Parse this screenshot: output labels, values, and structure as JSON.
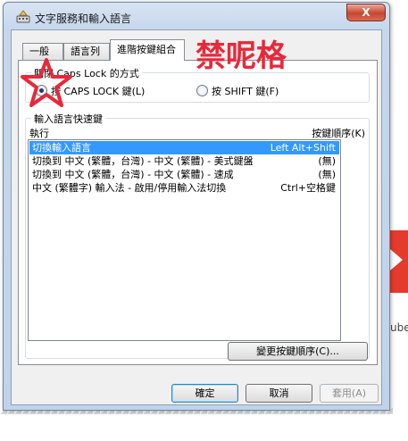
{
  "window": {
    "title": "文字服務和輸入語言",
    "close_label": "X"
  },
  "tabs": [
    {
      "label": "一般"
    },
    {
      "label": "語言列"
    },
    {
      "label": "進階按鍵組合"
    }
  ],
  "caps_group": {
    "label": "關閉 Caps Lock 的方式",
    "options": [
      {
        "label": "按 CAPS LOCK 鍵(L)",
        "checked": true
      },
      {
        "label": "按 SHIFT 鍵(F)",
        "checked": false
      }
    ]
  },
  "hotkeys_group": {
    "label": "輸入語言快速鍵",
    "columns": [
      "執行",
      "按鍵順序(K)"
    ],
    "rows": [
      {
        "action": "切換輸入語言",
        "keys": "Left Alt+Shift",
        "selected": true
      },
      {
        "action": "切換到 中文 (繁體，台灣) - 中文 (繁體) - 美式鍵盤",
        "keys": "(無)",
        "selected": false
      },
      {
        "action": "切換到 中文 (繁體，台灣) - 中文 (繁體) - 速成",
        "keys": "(無)",
        "selected": false
      },
      {
        "action": "中文 (繁體字) 輸入法 - 啟用/停用輸入法切換",
        "keys": "Ctrl+空格鍵",
        "selected": false
      }
    ],
    "change_button": "變更按鍵順序(C)..."
  },
  "footer": {
    "ok": "確定",
    "cancel": "取消",
    "apply": "套用(A)"
  },
  "annotation": {
    "text": "禁呢格",
    "color": "#e8283a"
  },
  "background": {
    "partial_text": "ube"
  },
  "icons": {
    "title": "keyboard-settings-icon",
    "star": "red-star-annotation-icon"
  }
}
